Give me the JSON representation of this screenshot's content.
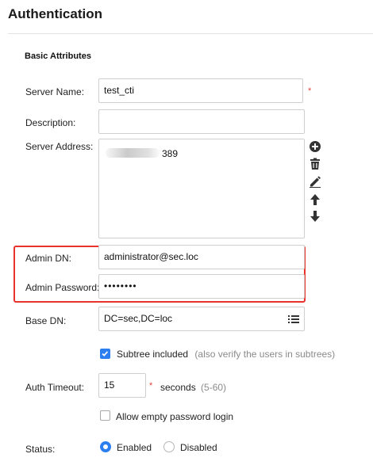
{
  "page": {
    "title": "Authentication"
  },
  "section": {
    "title": "Basic Attributes"
  },
  "fields": {
    "server_name": {
      "label": "Server Name:",
      "value": "test_cti",
      "required": "*"
    },
    "description": {
      "label": "Description:",
      "value": ""
    },
    "server_address": {
      "label": "Server Address:",
      "value_visible": "389"
    },
    "admin_dn": {
      "label": "Admin DN:",
      "value": "administrator@sec.loc"
    },
    "admin_password": {
      "label": "Admin Password:",
      "value": "••••••••"
    },
    "base_dn": {
      "label": "Base DN:",
      "value": "DC=sec,DC=loc"
    },
    "subtree": {
      "label": "Subtree included",
      "hint": "(also verify the users in subtrees)",
      "checked": true
    },
    "auth_timeout": {
      "label": "Auth Timeout:",
      "value": "15",
      "required": "*",
      "unit": "seconds",
      "range": "(5-60)"
    },
    "allow_empty": {
      "label": "Allow empty password login",
      "checked": false
    },
    "status": {
      "label": "Status:",
      "options": [
        "Enabled",
        "Disabled"
      ],
      "selected": "Enabled"
    }
  },
  "address_actions": [
    "add-icon",
    "delete-icon",
    "edit-icon",
    "move-up-icon",
    "move-down-icon"
  ],
  "colors": {
    "accent": "#2d7ff0",
    "highlight": "#e8322b",
    "required": "#e0463e",
    "hint": "#8a8a8a"
  }
}
